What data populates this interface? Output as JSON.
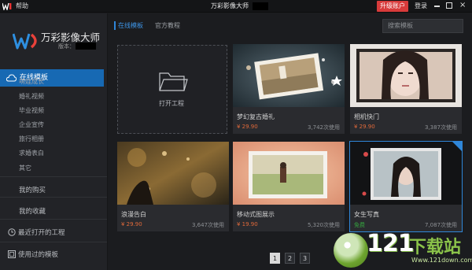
{
  "titlebar": {
    "help": "帮助",
    "title": "万彩影像大师",
    "upgrade": "升级账户",
    "login": "登录",
    "close": "×"
  },
  "sidebar": {
    "brand": "万彩影像大师",
    "version_label": "版本：",
    "online_templates": "在线模板",
    "categories": [
      "萌娃成长",
      "婚礼视频",
      "毕业视频",
      "企业宣传",
      "旅行相册",
      "求婚表白",
      "其它"
    ],
    "purchases": "我的购买",
    "favorites": "我的收藏",
    "recent_projects": "最近打开的工程",
    "used_templates": "使用过的模板"
  },
  "main": {
    "tabs": [
      "在线模板",
      "官方教程"
    ],
    "search_placeholder": "搜索模板",
    "open_project": "打开工程",
    "cards": [
      {
        "title": "梦幻复古婚礼",
        "price": "¥ 29.90",
        "uses": "3,742次使用"
      },
      {
        "title": "相机快门",
        "price": "¥ 29.90",
        "uses": "3,387次使用"
      },
      {
        "title": "浪漫告白",
        "price": "¥ 29.90",
        "uses": "3,647次使用"
      },
      {
        "title": "移动式图展示",
        "price": "¥ 19.90",
        "uses": "5,320次使用"
      },
      {
        "title": "女生写真",
        "price": "免费",
        "uses": "7,087次使用"
      }
    ],
    "pages": [
      "1",
      "2",
      "3"
    ]
  },
  "watermark": {
    "number": "121",
    "text": "下载站",
    "url": "Www.121down.com"
  }
}
